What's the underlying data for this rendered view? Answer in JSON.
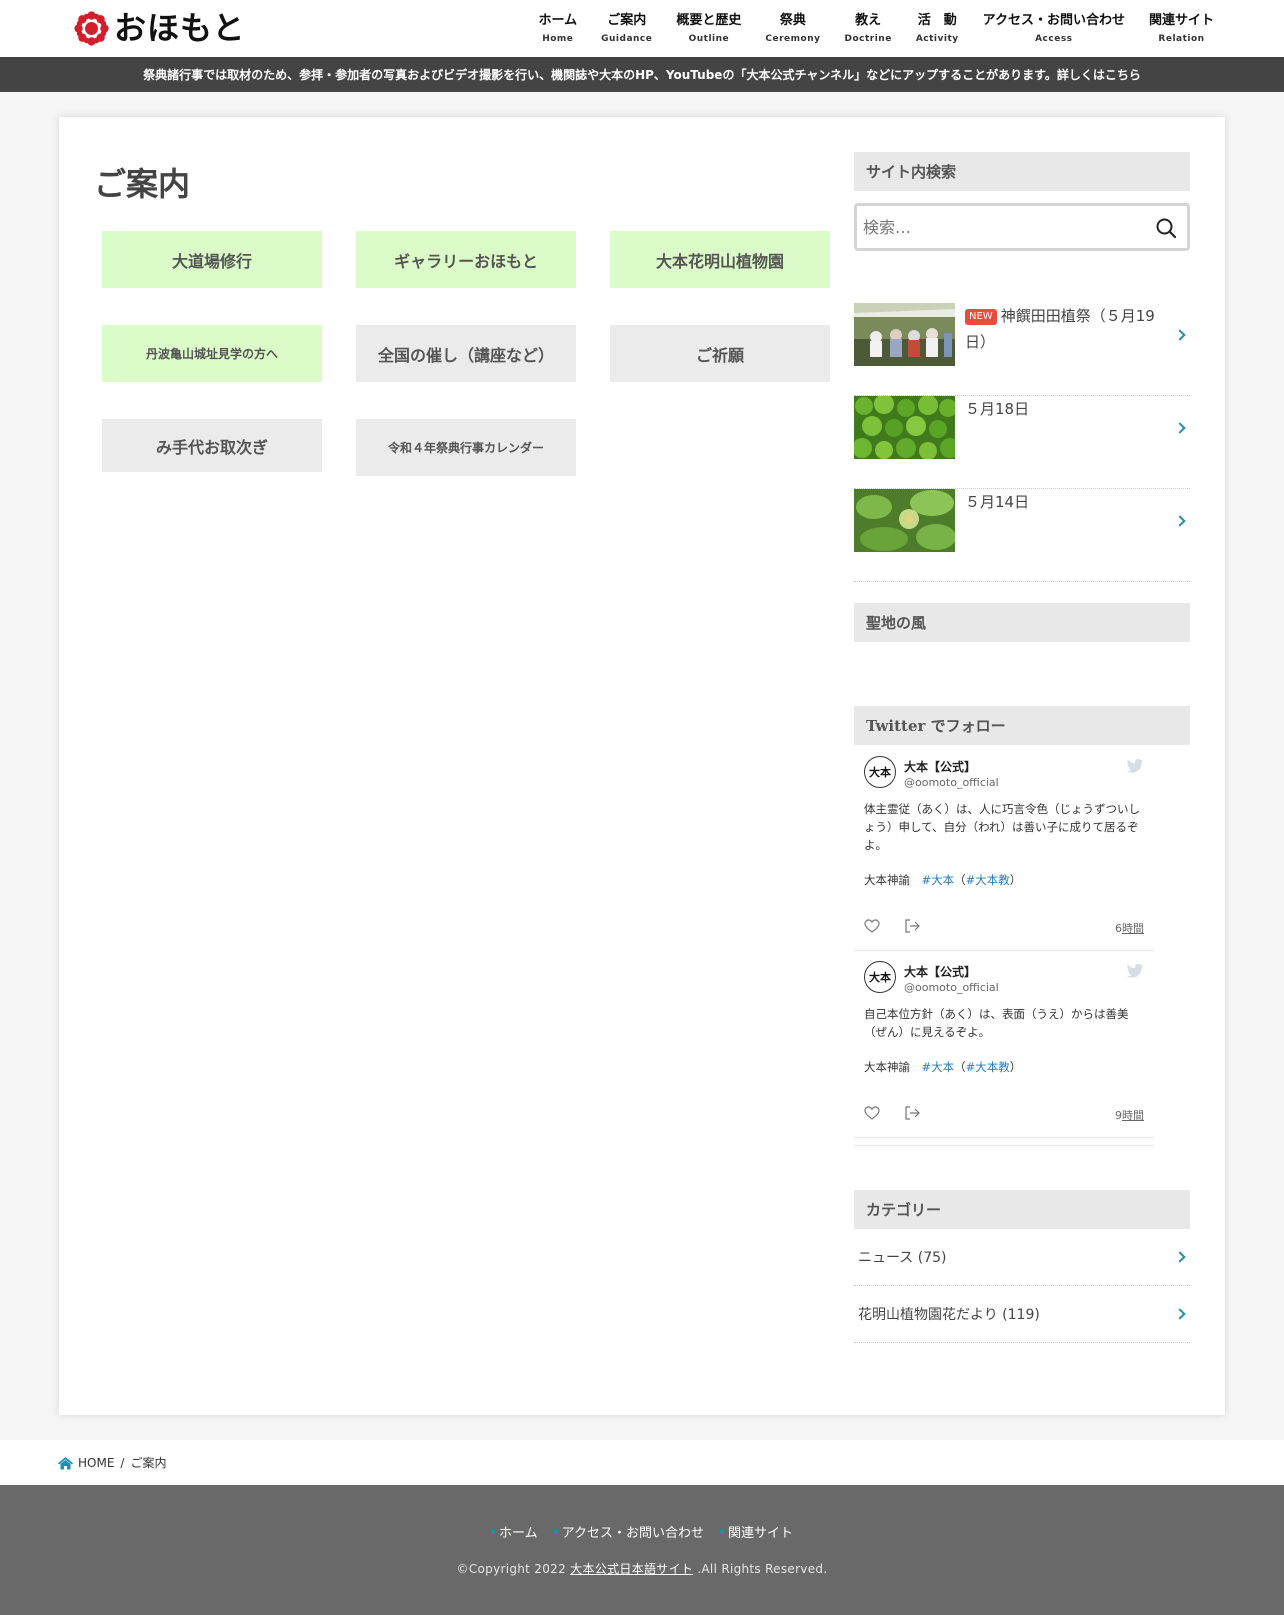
{
  "header": {
    "logo_text": "おほもと",
    "nav": [
      {
        "jp": "ホーム",
        "en": "Home"
      },
      {
        "jp": "ご案内",
        "en": "Guidance"
      },
      {
        "jp": "概要と歴史",
        "en": "Outline"
      },
      {
        "jp": "祭典",
        "en": "Ceremony"
      },
      {
        "jp": "教え",
        "en": "Doctrine"
      },
      {
        "jp": "活　動",
        "en": "Activity"
      },
      {
        "jp": "アクセス・お問い合わせ",
        "en": "Access"
      },
      {
        "jp": "関連サイト",
        "en": "Relation"
      }
    ]
  },
  "notice": "祭典諸行事では取材のため、参拝・参加者の写真およびビデオ撮影を行い、機関誌や大本のHP、YouTubeの「大本公式チャンネル」などにアップすることがあります。詳しくはこちら",
  "main": {
    "title": "ご案内",
    "tiles": [
      {
        "label": "大道場修行"
      },
      {
        "label": "ギャラリーおほもと"
      },
      {
        "label": "大本花明山植物園"
      },
      {
        "label": "丹波亀山城址見学の方へ"
      },
      {
        "label": "全国の催し（講座など）"
      },
      {
        "label": "ご祈願"
      },
      {
        "label": "み手代お取次ぎ"
      },
      {
        "label": "令和４年祭典行事カレンダー"
      }
    ]
  },
  "sidebar": {
    "search": {
      "title": "サイト内検索",
      "placeholder": "検索…"
    },
    "posts": [
      {
        "badge": "NEW",
        "title": "神饌田田植祭（５月19日）"
      },
      {
        "title": "５月18日"
      },
      {
        "title": "５月14日"
      }
    ],
    "seichi_title": "聖地の風",
    "twitter": {
      "title": "Twitter でフォロー",
      "tweets": [
        {
          "avatar": "大本",
          "name": "大本【公式】",
          "handle": "@oomoto_official",
          "text": "体主霊従（あく）は、人に巧言令色（じょうずついしょう）申して、自分（われ）は善い子に成りて居るぞよ。",
          "source": "大本神諭",
          "tag1": "#大本",
          "tag2": "#大本教",
          "time_num": "6",
          "time_unit": "時間"
        },
        {
          "avatar": "大本",
          "name": "大本【公式】",
          "handle": "@oomoto_official",
          "text": "自己本位方針（あく）は、表面（うえ）からは善美（ぜん）に見えるぞよ。",
          "source": "大本神諭",
          "tag1": "#大本",
          "tag2": "#大本教",
          "time_num": "9",
          "time_unit": "時間"
        }
      ]
    },
    "categories": {
      "title": "カテゴリー",
      "items": [
        {
          "label": "ニュース (75)"
        },
        {
          "label": "花明山植物園花だより (119)"
        }
      ]
    }
  },
  "breadcrumb": {
    "home": "HOME",
    "sep": "/",
    "current": "ご案内"
  },
  "footer": {
    "nav": [
      {
        "label": "ホーム"
      },
      {
        "label": "アクセス・お問い合わせ"
      },
      {
        "label": "関連サイト"
      }
    ],
    "copyright_prefix": "©Copyright 2022",
    "copyright_link": "大本公式日本語サイト",
    "copyright_suffix": ".All Rights Reserved."
  },
  "colors": {
    "accent": "#1e8fb0",
    "logo_red": "#d21f2b",
    "tile_green": "#dbfcc8",
    "tile_gray": "#ebebeb",
    "notice_bg": "#444444",
    "footer_bg": "#696969",
    "new_badge": "#e74c3c",
    "hashtag": "#2b7bb9"
  }
}
